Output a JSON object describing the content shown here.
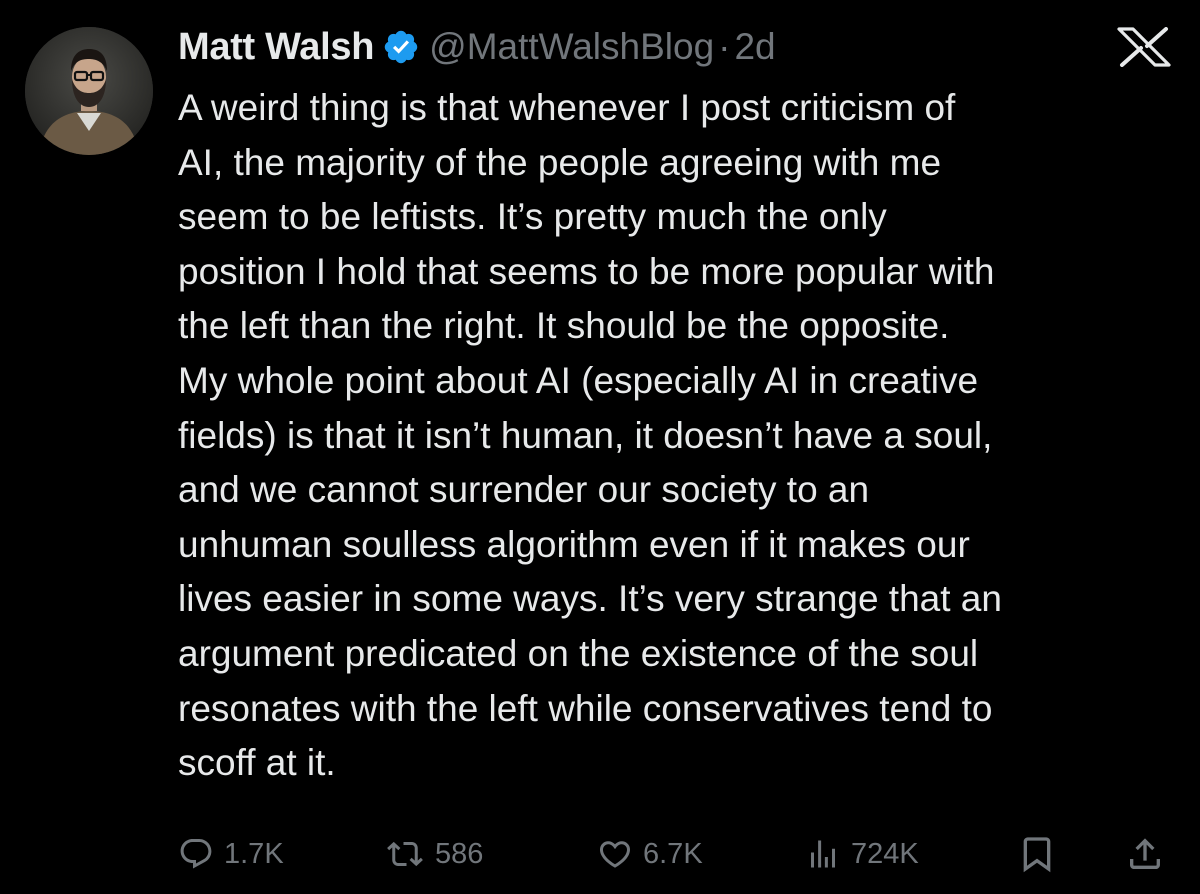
{
  "tweet": {
    "author_name": "Matt Walsh",
    "handle": "@MattWalshBlog",
    "separator": "·",
    "time": "2d",
    "verified_badge_icon": "verified-badge-icon",
    "platform_logo_icon": "x-logo-icon",
    "text": "A weird thing is that whenever I post criticism of\nAI, the majority of the people agreeing with me\nseem to be leftists. It’s pretty much the only\nposition I hold that seems to be more popular with\nthe left than the right. It should be the opposite.\nMy whole point about AI (especially AI in creative\nfields) is that it isn’t human, it doesn’t have a soul,\nand we cannot surrender our society to an\nunhuman soulless algorithm even if it makes our\nlives easier in some ways. It’s very strange that an\nargument predicated on the existence of the soul\nresonates with the left while conservatives tend to\nscoff at it."
  },
  "actions": {
    "reply": {
      "icon": "reply-icon",
      "count": "1.7K"
    },
    "retweet": {
      "icon": "retweet-icon",
      "count": "586"
    },
    "like": {
      "icon": "heart-icon",
      "count": "6.7K"
    },
    "views": {
      "icon": "views-icon",
      "count": "724K"
    },
    "bookmark": {
      "icon": "bookmark-icon"
    },
    "share": {
      "icon": "share-icon"
    }
  },
  "colors": {
    "background": "#000000",
    "primary_text": "#e7e9ea",
    "secondary_text": "#71767b",
    "verified_blue": "#1d9bf0"
  }
}
